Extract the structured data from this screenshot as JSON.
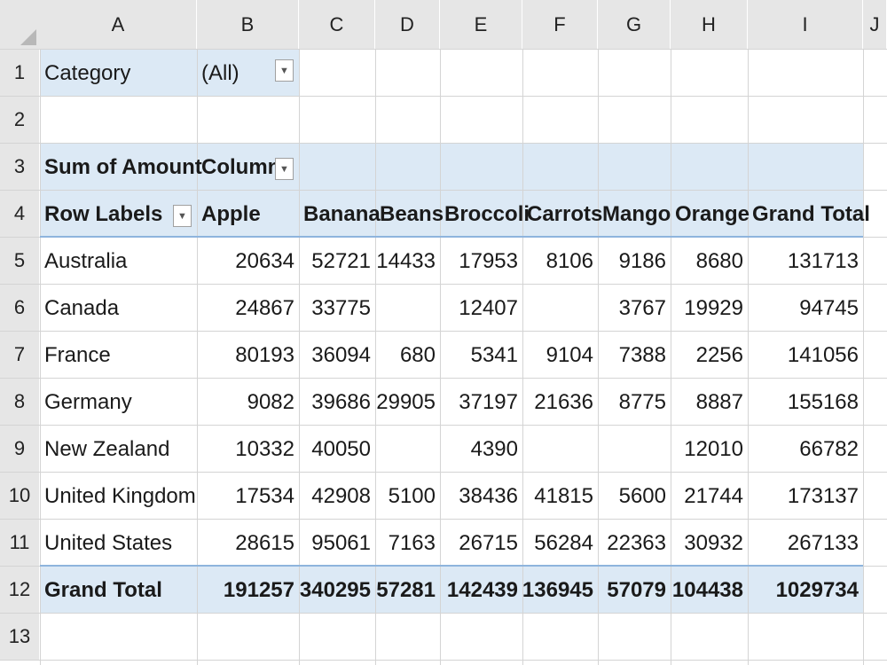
{
  "columns": [
    "A",
    "B",
    "C",
    "D",
    "E",
    "F",
    "G",
    "H",
    "I",
    "J"
  ],
  "rows": [
    "1",
    "2",
    "3",
    "4",
    "5",
    "6",
    "7",
    "8",
    "9",
    "10",
    "11",
    "12",
    "13"
  ],
  "filter": {
    "label": "Category",
    "value": "(All)"
  },
  "pivot_header": {
    "values_label": "Sum of Amount",
    "columns_label": "Column"
  },
  "row_labels_header": "Row Labels",
  "products": [
    "Apple",
    "Banana",
    "Beans",
    "Broccoli",
    "Carrots",
    "Mango",
    "Orange"
  ],
  "grand_total_label": "Grand Total",
  "data_rows": [
    {
      "label": "Australia",
      "values": [
        "20634",
        "52721",
        "14433",
        "17953",
        "8106",
        "9186",
        "8680"
      ],
      "total": "131713"
    },
    {
      "label": "Canada",
      "values": [
        "24867",
        "33775",
        "",
        "12407",
        "",
        "3767",
        "19929"
      ],
      "total": "94745"
    },
    {
      "label": "France",
      "values": [
        "80193",
        "36094",
        "680",
        "5341",
        "9104",
        "7388",
        "2256"
      ],
      "total": "141056"
    },
    {
      "label": "Germany",
      "values": [
        "9082",
        "39686",
        "29905",
        "37197",
        "21636",
        "8775",
        "8887"
      ],
      "total": "155168"
    },
    {
      "label": "New Zealand",
      "values": [
        "10332",
        "40050",
        "",
        "4390",
        "",
        "",
        "12010"
      ],
      "total": "66782"
    },
    {
      "label": "United Kingdom",
      "values": [
        "17534",
        "42908",
        "5100",
        "38436",
        "41815",
        "5600",
        "21744"
      ],
      "total": "173137"
    },
    {
      "label": "United States",
      "values": [
        "28615",
        "95061",
        "7163",
        "26715",
        "56284",
        "22363",
        "30932"
      ],
      "total": "267133"
    }
  ],
  "grand_total_row": {
    "label": "Grand Total",
    "values": [
      "191257",
      "340295",
      "57281",
      "142439",
      "136945",
      "57079",
      "104438"
    ],
    "total": "1029734"
  },
  "dropdown_icon": "triangle-down",
  "colors": {
    "header_bg": "#e6e6e6",
    "pivot_band": "#dce9f5",
    "total_line": "#8eb4dd",
    "grid": "#d4d4d4"
  }
}
